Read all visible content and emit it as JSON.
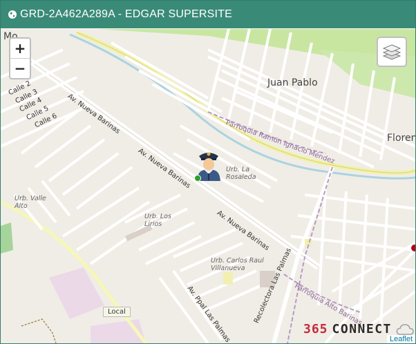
{
  "header": {
    "title": "GRD-2A462A289A - EDGAR SUPERSITE",
    "background": "#3a8a78"
  },
  "controls": {
    "zoom_in": "+",
    "zoom_out": "−",
    "layers_icon": "layers-icon"
  },
  "map_labels": {
    "streets": [
      "Calle 2",
      "Calle 3",
      "Calle 4",
      "Calle 5",
      "Calle 6",
      "Av. Nueva Barinas",
      "Av. Nueva Barinas",
      "Av. Nueva Barinas",
      "Recolectora Las Palmas",
      "Av. Ppal Las Palmas"
    ],
    "places": [
      "Juan Pablo",
      "Floren",
      "Mo"
    ],
    "urbanizations": [
      "Urb. La Rosaleda",
      "Urb. Valle Alto",
      "Urb. Los Lirios",
      "Urb. Carlos Raul Villanueva"
    ],
    "parishes": [
      "Parroquia Ramón Ignacio Méndez",
      "Parroquia Alto Barinas"
    ]
  },
  "poi": {
    "local": "Local"
  },
  "brand": {
    "number": "365",
    "word": "CONNECT",
    "accent": "#c6293a"
  },
  "attribution": "Leaflet",
  "colors": {
    "land": "#f0ede6",
    "green": "#c8e6a0",
    "road": "#ffffff",
    "water": "#aad3df",
    "highway": "#f6f7b8"
  }
}
